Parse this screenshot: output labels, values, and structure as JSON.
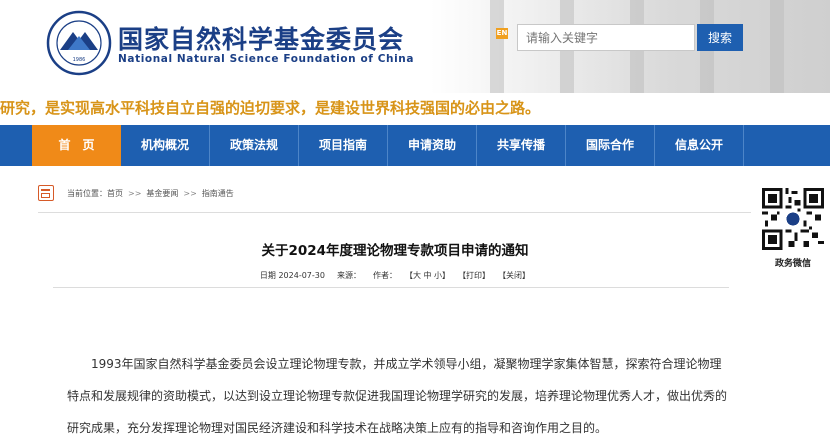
{
  "header": {
    "site_name_cn": "国家自然科学基金委员会",
    "site_name_en": "National Natural Science Foundation of China",
    "logo_year": "1986",
    "en_badge": "EN",
    "search_placeholder": "请输入关键字",
    "search_button": "搜索"
  },
  "slogan": "研究，是实现高水平科技自立自强的迫切要求，是建设世界科技强国的必由之路。",
  "nav": [
    "首　页",
    "机构概况",
    "政策法规",
    "项目指南",
    "申请资助",
    "共享传播",
    "国际合作",
    "信息公开"
  ],
  "breadcrumb": {
    "prefix": "当前位置：",
    "items": [
      "首页",
      "基金要闻",
      "指南通告"
    ],
    "separator": ">>"
  },
  "qr_caption": "政务微信",
  "article": {
    "title": "关于2024年度理论物理专款项目申请的通知",
    "date": "日期 2024-07-30",
    "source": "来源：",
    "author": "作者：",
    "font_size": "【大 中 小】",
    "print": "【打印】",
    "close": "【关闭】",
    "paragraph": "1993年国家自然科学基金委员会设立理论物理专款，并成立学术领导小组，凝聚物理学家集体智慧，探索符合理论物理特点和发展规律的资助模式，以达到设立理论物理专款促进我国理论物理学研究的发展，培养理论物理优秀人才，做出优秀的研究成果，充分发挥理论物理对国民经济建设和科学技术在战略决策上应有的指导和咨询作用之目的。"
  },
  "colors": {
    "brand_blue": "#1e5fb0",
    "nav_active": "#f08a18",
    "slogan": "#d89418",
    "title_blue": "#1b3f86"
  }
}
